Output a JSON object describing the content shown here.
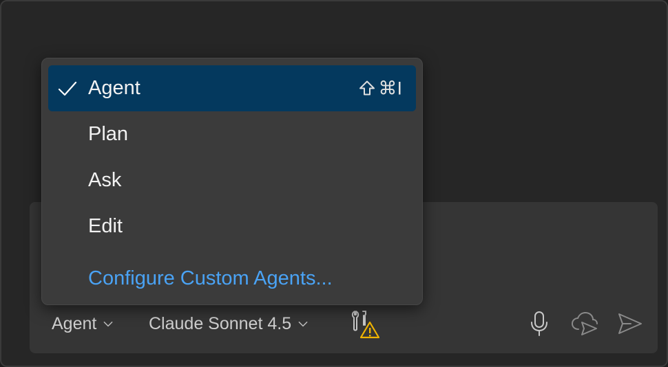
{
  "menu": {
    "items": [
      {
        "label": "Agent",
        "selected": true,
        "shortcut": "⌘I"
      },
      {
        "label": "Plan"
      },
      {
        "label": "Ask"
      },
      {
        "label": "Edit"
      }
    ],
    "link_label": "Configure Custom Agents...",
    "link_color": "#4aa3f5",
    "selected_bg": "#04395e"
  },
  "toolbar": {
    "mode_label": "Agent",
    "model_label": "Claude Sonnet 4.5"
  },
  "icons": {
    "check": "check-icon",
    "shift": "shift-icon",
    "mode_chevron": "chevron-down-icon",
    "model_chevron": "chevron-down-icon",
    "tools": "tools-warning-icon",
    "mic": "microphone-icon",
    "cloud_send": "cloud-send-icon",
    "send": "send-icon"
  }
}
